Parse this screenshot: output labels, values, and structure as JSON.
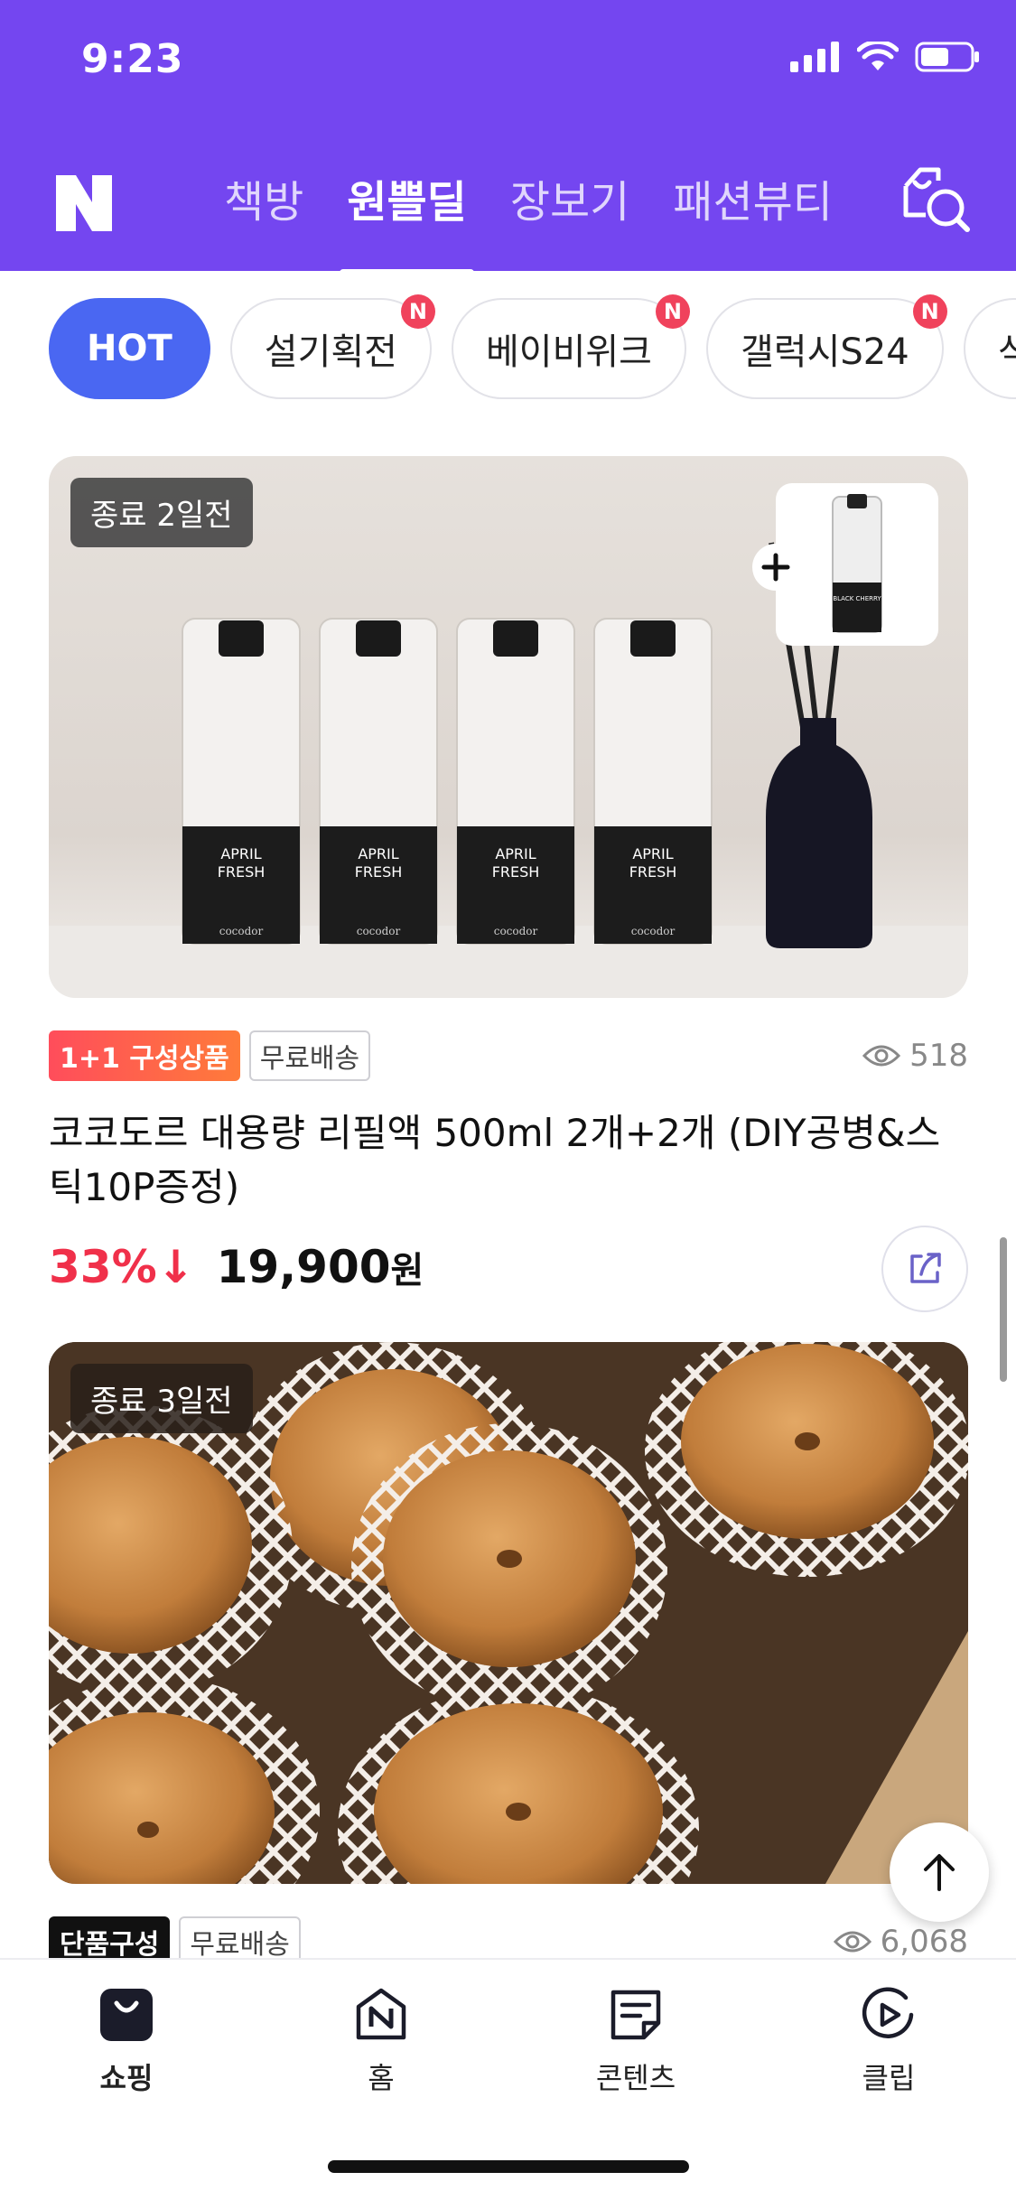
{
  "status": {
    "time": "9:23"
  },
  "header": {
    "tabs": [
      {
        "label": "책방"
      },
      {
        "label": "원쁠딜",
        "active": true
      },
      {
        "label": "장보기"
      },
      {
        "label": "패션뷰티"
      }
    ]
  },
  "chips": [
    {
      "label": "HOT"
    },
    {
      "label": "설기획전",
      "badge": "N"
    },
    {
      "label": "베이비위크",
      "badge": "N"
    },
    {
      "label": "갤럭시S24",
      "badge": "N"
    },
    {
      "label": "식"
    }
  ],
  "products": [
    {
      "deadline": "종료 2일전",
      "tag_primary": "1+1 구성상품",
      "tag_shipping": "무료배송",
      "views": "518",
      "title": "코코도르 대용량 리필액 500ml 2개+2개 (DIY공병&스틱10P증정)",
      "discount": "33%↓",
      "price": "19,900",
      "currency": "원",
      "image_text": {
        "bottle_label_1": "APRIL",
        "bottle_label_2": "FRESH",
        "brand": "cocodor",
        "inset_label": "BLACK CHERRY"
      }
    },
    {
      "deadline": "종료 3일전",
      "tag_primary": "단품구성",
      "tag_shipping": "무료배송",
      "views": "6,068"
    }
  ],
  "bottom_nav": [
    {
      "label": "쇼핑",
      "icon": "shopping-bag-icon",
      "active": true
    },
    {
      "label": "홈",
      "icon": "home-n-icon"
    },
    {
      "label": "콘텐츠",
      "icon": "contents-icon"
    },
    {
      "label": "클립",
      "icon": "clip-play-icon"
    }
  ],
  "colors": {
    "header": "#7446f0",
    "hot_chip": "#4a67f2",
    "discount": "#f0304a",
    "badge": "#f0425c"
  }
}
